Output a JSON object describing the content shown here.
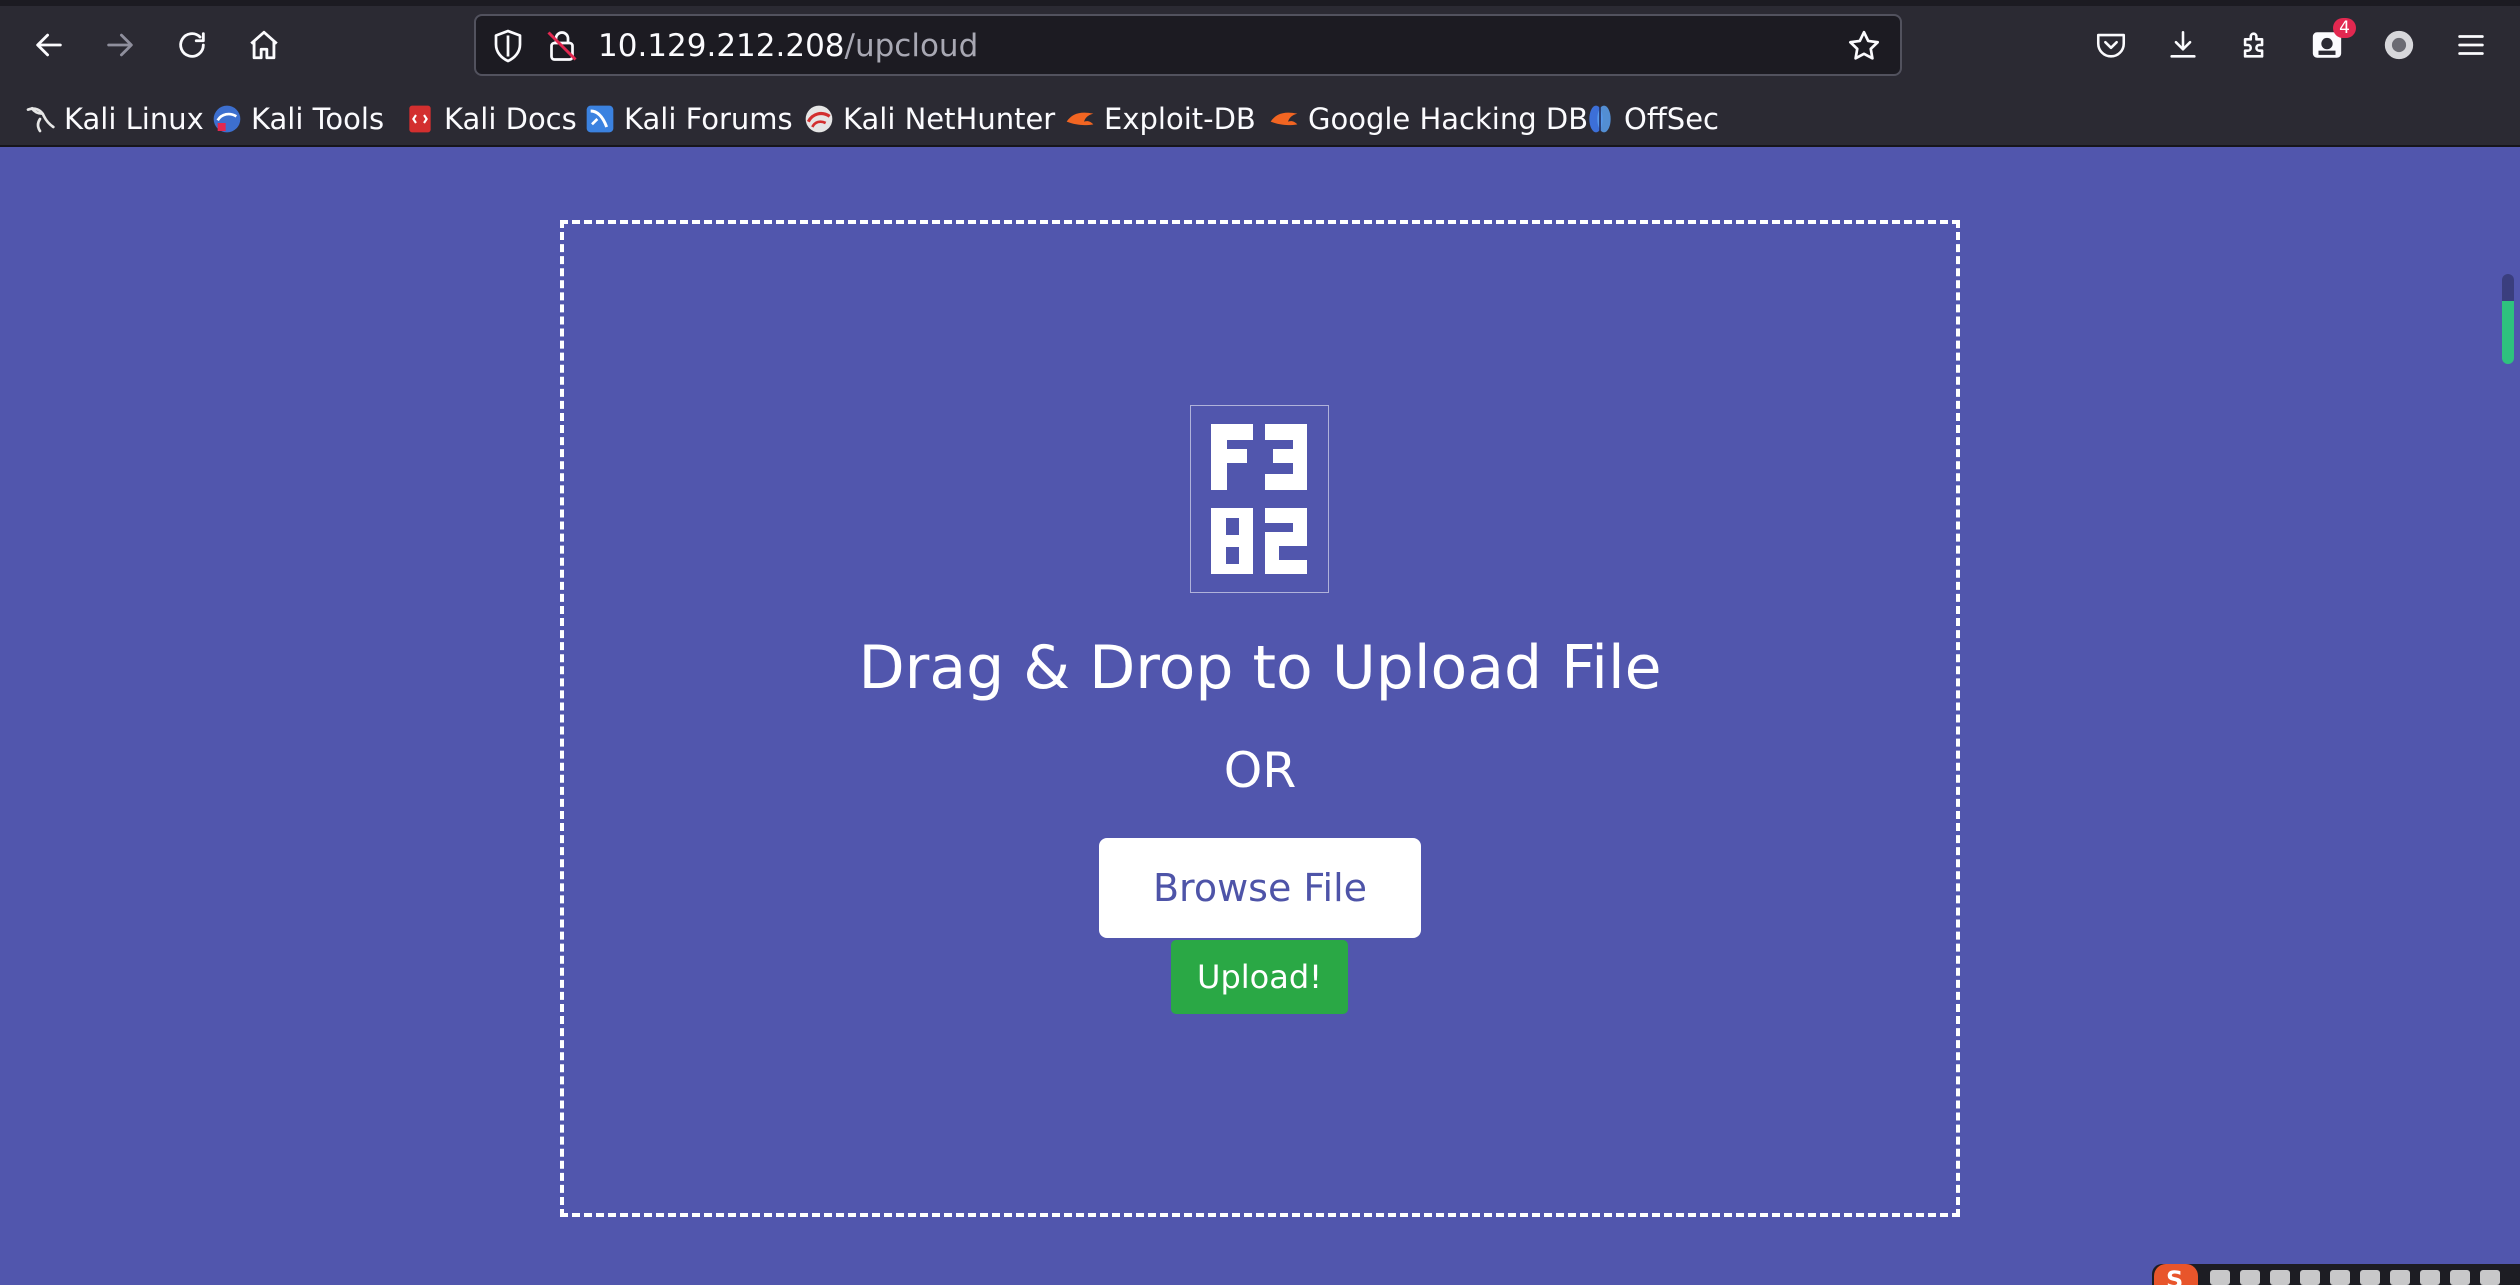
{
  "browser": {
    "url_host": "10.129.212.208",
    "url_path": "/upcloud",
    "extensions_badge": "4"
  },
  "bookmarks": [
    {
      "label": "Kali Linux",
      "icon": "kali-dragon-icon"
    },
    {
      "label": "Kali Tools",
      "icon": "kali-tools-icon"
    },
    {
      "label": "Kali Docs",
      "icon": "kali-docs-icon"
    },
    {
      "label": "Kali Forums",
      "icon": "kali-forums-icon"
    },
    {
      "label": "Kali NetHunter",
      "icon": "kali-nethunter-icon"
    },
    {
      "label": "Exploit-DB",
      "icon": "exploit-db-icon"
    },
    {
      "label": "Google Hacking DB",
      "icon": "ghdb-icon"
    },
    {
      "label": "OffSec",
      "icon": "offsec-icon"
    }
  ],
  "upload": {
    "heading": "Drag & Drop to Upload File",
    "or_text": "OR",
    "browse_label": "Browse File",
    "upload_label": "Upload!"
  },
  "colors": {
    "background": "#5156ad",
    "toolbar": "#2b2a33",
    "upload_button": "#2aa845",
    "browse_text": "#4e54a8"
  }
}
